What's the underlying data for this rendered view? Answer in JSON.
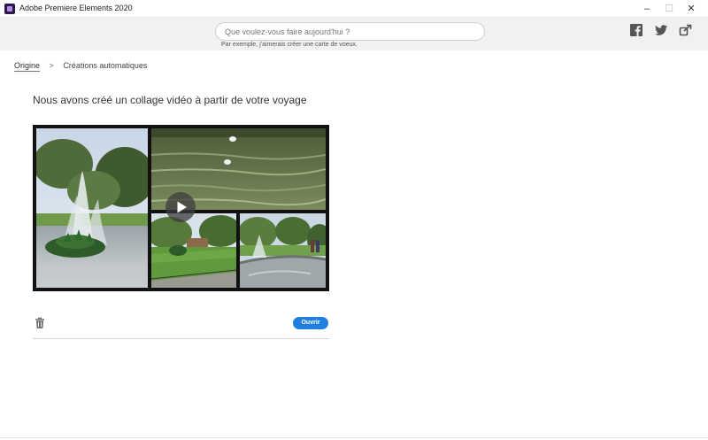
{
  "window": {
    "title": "Adobe Premiere Elements 2020",
    "controls": {
      "minimize": "–",
      "maximize": "☐",
      "close": "✕"
    }
  },
  "search": {
    "placeholder": "Que voulez-vous faire aujourd'hui ?",
    "hint": "Par exemple, j'aimerais créer une carte de voeux."
  },
  "social": {
    "icons": [
      "facebook-icon",
      "twitter-icon",
      "share-icon"
    ],
    "icon_color": "#555555"
  },
  "breadcrumb": {
    "root": "Origine",
    "separator": ">",
    "current": "Créations automatiques"
  },
  "main": {
    "heading": "Nous avons créé un collage vidéo à partir de votre voyage"
  },
  "collage": {
    "tiles": [
      "fountain-tile",
      "pond-tile",
      "lawn-tile",
      "pool-tile"
    ],
    "play_icon": "play-icon"
  },
  "actions": {
    "delete_icon": "trash-icon",
    "open_label": "Ouvrir",
    "accent": "#1f7fe0"
  }
}
